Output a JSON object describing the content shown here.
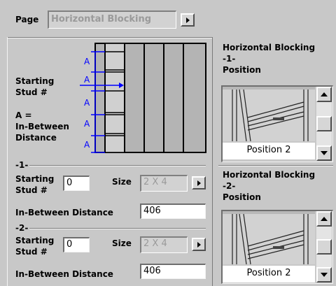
{
  "page": {
    "label": "Page",
    "value": "Horizontal Blocking"
  },
  "diagram": {
    "starting_stud": "Starting\nStud #",
    "a_equals": "A =\nIn-Between\nDistance",
    "a_marker": "A"
  },
  "blocking1": {
    "group_label": "-1-",
    "starting_stud_label": "Starting\nStud #",
    "starting_stud_value": "0",
    "size_label": "Size",
    "size_value": "2 X 4",
    "in_between_label": "In-Between Distance",
    "in_between_value": "406"
  },
  "blocking2": {
    "group_label": "-2-",
    "starting_stud_label": "Starting\nStud #",
    "starting_stud_value": "0",
    "size_label": "Size",
    "size_value": "2 X 4",
    "in_between_label": "In-Between Distance",
    "in_between_value": "406"
  },
  "right": {
    "pos1_title": "Horizontal Blocking\n-1-\nPosition",
    "pos1_value": "Position 2",
    "pos2_title": "Horizontal Blocking\n-2-\nPosition",
    "pos2_value": "Position 2"
  },
  "colors": {
    "background": "#c8c8c8",
    "accent_line": "#0000ff"
  }
}
